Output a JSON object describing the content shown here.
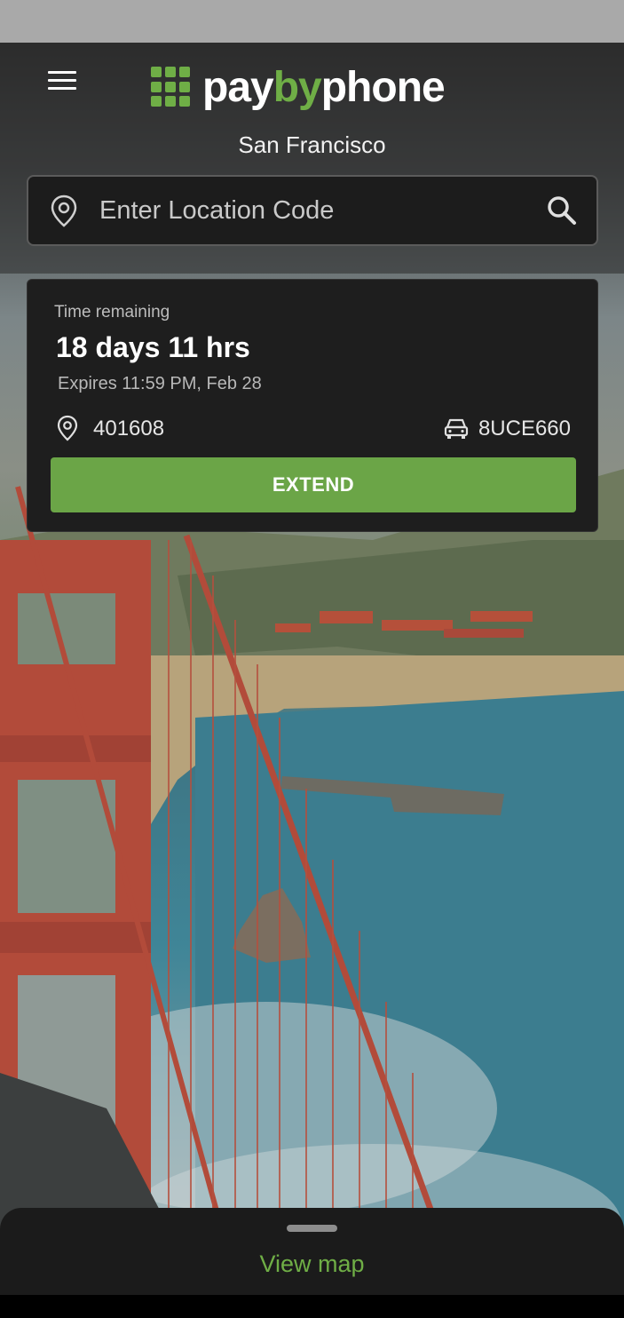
{
  "app": {
    "logo_prefix": "pay",
    "logo_middle": "by",
    "logo_suffix": "phone",
    "city": "San Francisco"
  },
  "icons": {
    "menu": "menu-icon",
    "location_pin": "location-pin-icon",
    "search": "search-icon",
    "car": "car-icon"
  },
  "search": {
    "placeholder": "Enter Location Code",
    "value": ""
  },
  "session": {
    "label": "Time remaining",
    "remaining": "18 days 11 hrs",
    "expires": "Expires 11:59 PM, Feb 28",
    "location_code": "401608",
    "plate": "8UCE660",
    "extend_label": "EXTEND"
  },
  "bottom_sheet": {
    "view_map_label": "View map"
  },
  "colors": {
    "brand_green": "#6fae46",
    "button_green": "#6ba547",
    "card_bg": "#1e1e1e"
  }
}
